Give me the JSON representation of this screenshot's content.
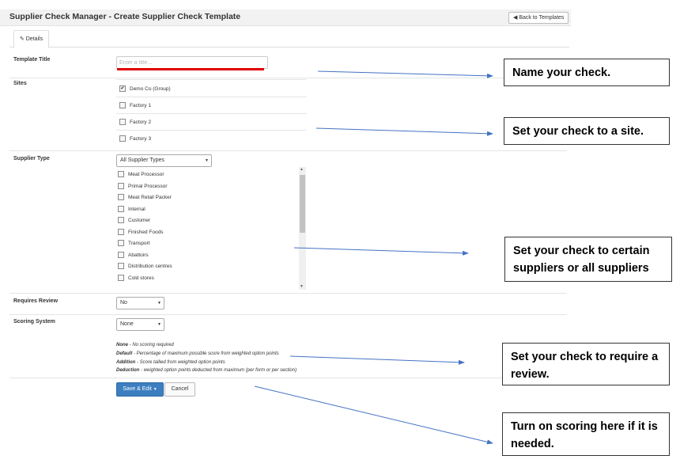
{
  "header": {
    "title": "Supplier Check Manager - Create Supplier Check Template",
    "back_button": "Back to Templates"
  },
  "tabs": [
    {
      "label": "Details"
    }
  ],
  "form": {
    "template_title": {
      "label": "Template Title",
      "placeholder": "Enter a title..."
    },
    "sites": {
      "label": "Sites",
      "items": [
        {
          "label": "Demo Co (Group)",
          "checked": true
        },
        {
          "label": "Factory 1",
          "checked": false
        },
        {
          "label": "Factory 2",
          "checked": false
        },
        {
          "label": "Factory 3",
          "checked": false
        }
      ]
    },
    "supplier_type": {
      "label": "Supplier Type",
      "selected": "All Supplier Types",
      "items": [
        "Meat Processor",
        "Primal Processor",
        "Meat Retail Packer",
        "Internal",
        "Customer",
        "Finished Foods",
        "Transport",
        "Abattoirs",
        "Distribution centres",
        "Cold stores"
      ]
    },
    "requires_review": {
      "label": "Requires Review",
      "selected": "No"
    },
    "scoring_system": {
      "label": "Scoring System",
      "selected": "None",
      "help": [
        {
          "term": "None",
          "desc": " - No scoring required"
        },
        {
          "term": "Default",
          "desc": " - Percentage of maximum possible score from weighted option points"
        },
        {
          "term": "Addition",
          "desc": " - Score tallied from weighted option points"
        },
        {
          "term": "Deduction",
          "desc": " - weighted option points deducted from maximum (per form or per section)"
        }
      ]
    },
    "buttons": {
      "save": "Save & Edit",
      "cancel": "Cancel"
    }
  },
  "callouts": [
    {
      "text": "Name your check."
    },
    {
      "text": "Set your check to a site."
    },
    {
      "text": "Set your check to certain suppliers or all suppliers"
    },
    {
      "text": "Set your check to require a review."
    },
    {
      "text": "Turn on scoring here if it is needed."
    }
  ],
  "colors": {
    "accent": "#3c7ec0",
    "underline": "#e00000",
    "arrow": "#4472c4"
  }
}
